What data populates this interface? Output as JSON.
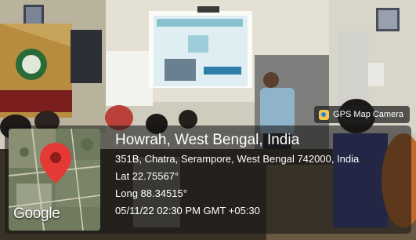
{
  "stamp_app": "GPS Map Camera",
  "location": {
    "city": "Howrah, West Bengal, India",
    "address": "351B, Chatra, Serampore, West Bengal 742000, India",
    "lat": "Lat 22.75567°",
    "long": "Long 88.34515°",
    "datetime": "05/11/22 02:30 PM GMT +05:30"
  },
  "map_brand": "Google",
  "colors": {
    "overlay": "#141414",
    "pin": "#e53935"
  }
}
